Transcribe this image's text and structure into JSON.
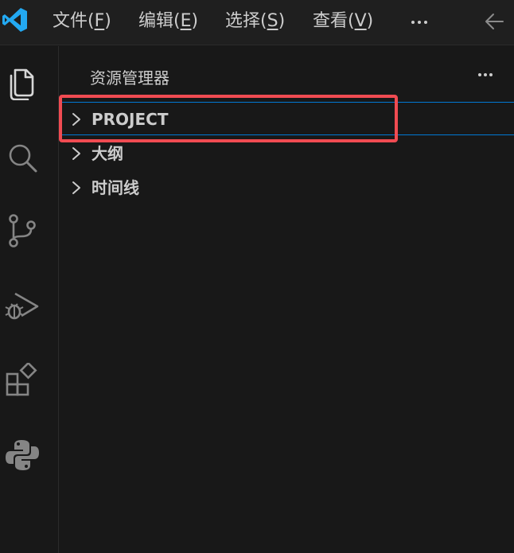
{
  "menu": {
    "file": "文件(",
    "file_key": "F",
    "edit": "编辑(",
    "edit_key": "E",
    "selection": "选择(",
    "selection_key": "S",
    "view": "查看(",
    "view_key": "V",
    "close_paren": ")"
  },
  "sidebar": {
    "title": "资源管理器",
    "sections": [
      {
        "label": "PROJECT"
      },
      {
        "label": "大纲"
      },
      {
        "label": "时间线"
      }
    ]
  },
  "activity_icons": [
    "explorer-icon",
    "search-icon",
    "source-control-icon",
    "run-debug-icon",
    "extensions-icon",
    "python-icon"
  ],
  "colors": {
    "background": "#181818",
    "accent": "#0078d4",
    "highlight": "#f04b52",
    "logo": "#23a9f2"
  }
}
